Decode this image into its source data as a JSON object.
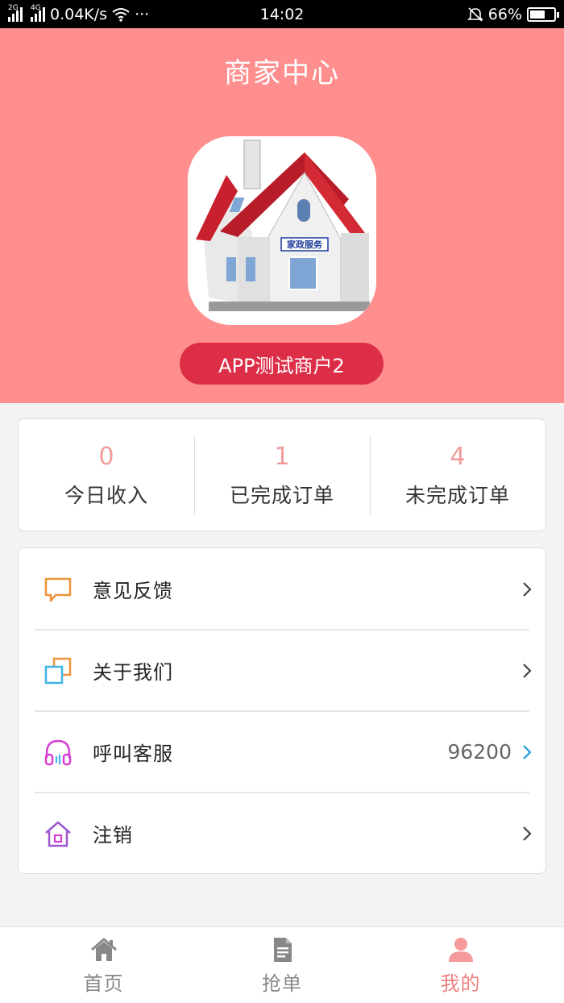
{
  "status_bar": {
    "net_2g": "2G",
    "net_4g": "4G",
    "speed": "0.04K/s",
    "dots": "···",
    "time": "14:02",
    "battery": "66%"
  },
  "header": {
    "title": "商家中心",
    "merchant_name": "APP测试商户2",
    "avatar_sign": "家政服务"
  },
  "stats": [
    {
      "value": "0",
      "label": "今日收入"
    },
    {
      "value": "1",
      "label": "已完成订单"
    },
    {
      "value": "4",
      "label": "未完成订单"
    }
  ],
  "menu": {
    "feedback": {
      "label": "意见反馈"
    },
    "about": {
      "label": "关于我们"
    },
    "service": {
      "label": "呼叫客服",
      "value": "96200"
    },
    "logout": {
      "label": "注销"
    }
  },
  "tabbar": [
    {
      "label": "首页",
      "icon": "home-icon"
    },
    {
      "label": "抢单",
      "icon": "document-icon"
    },
    {
      "label": "我的",
      "icon": "user-icon"
    }
  ],
  "colors": {
    "header_bg": "#ff8f8f",
    "name_pill": "#dd2e48",
    "accent": "#f07f7f"
  }
}
